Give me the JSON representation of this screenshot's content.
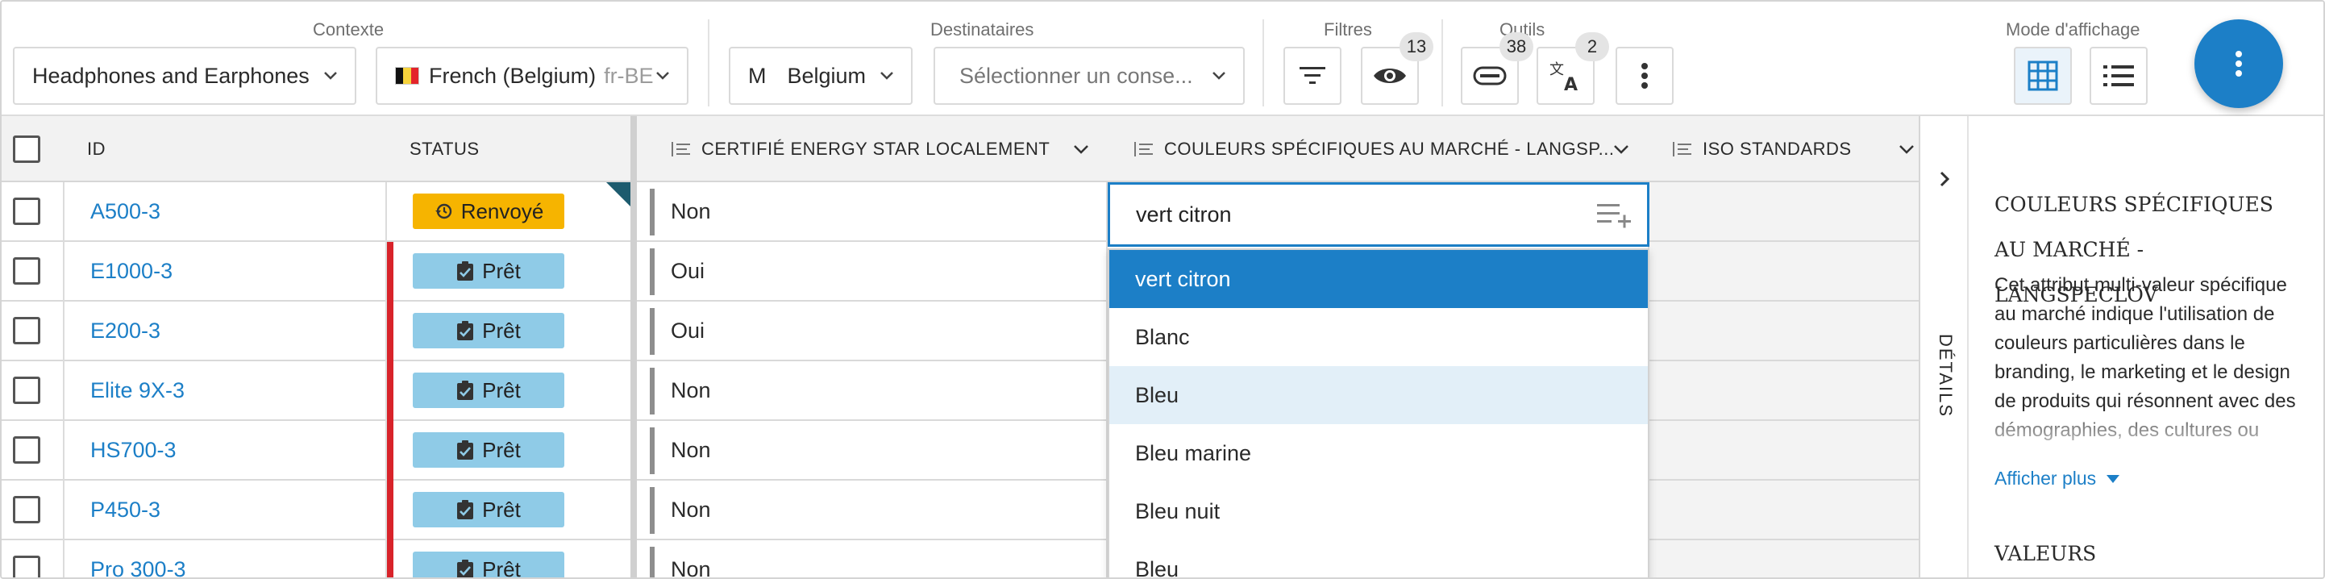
{
  "toolbar": {
    "groups": {
      "context": "Contexte",
      "recipients": "Destinataires",
      "filters": "Filtres",
      "tools": "Outils",
      "display_mode": "Mode d'affichage"
    },
    "category_select": "Headphones and Earphones",
    "locale_select": {
      "label": "French (Belgium)",
      "code": "fr-BE"
    },
    "market_select": {
      "prefix": "M",
      "label": "Belgium"
    },
    "advisor_select": {
      "placeholder": "Sélectionner un conse..."
    },
    "badges": {
      "visibility": "13",
      "link": "38",
      "translate": "2"
    },
    "colors": {
      "accent": "#1c7fc7",
      "ready": "#8fcbe7",
      "returned": "#f6b400",
      "error_bar": "#d8232a"
    }
  },
  "grid": {
    "columns": {
      "id": "ID",
      "status": "STATUS",
      "energy_star": "CERTIFIÉ ENERGY STAR LOCALEMENT",
      "colors": "COULEURS SPÉCIFIQUES AU MARCHÉ - LANGSP...",
      "iso": "ISO STANDARDS"
    },
    "rows": [
      {
        "id": "A500-3",
        "status": "Renvoyé",
        "status_kind": "returned",
        "energy": "Non"
      },
      {
        "id": "E1000-3",
        "status": "Prêt",
        "status_kind": "ready",
        "energy": "Oui"
      },
      {
        "id": "E200-3",
        "status": "Prêt",
        "status_kind": "ready",
        "energy": "Oui"
      },
      {
        "id": "Elite 9X-3",
        "status": "Prêt",
        "status_kind": "ready",
        "energy": "Non"
      },
      {
        "id": "HS700-3",
        "status": "Prêt",
        "status_kind": "ready",
        "energy": "Non"
      },
      {
        "id": "P450-3",
        "status": "Prêt",
        "status_kind": "ready",
        "energy": "Non"
      },
      {
        "id": "Pro 300-3",
        "status": "Prêt",
        "status_kind": "ready",
        "energy": "Non"
      }
    ],
    "edit": {
      "value": "vert citron",
      "options": [
        "vert citron",
        "Blanc",
        "Bleu",
        "Bleu marine",
        "Bleu nuit",
        "Bleu"
      ]
    }
  },
  "details": {
    "tab_label": "DÉTAILS",
    "title": "COULEURS SPÉCIFIQUES AU MARCHÉ - LANGSPECLOV",
    "description": "Cet attribut multi-valeur spécifique au marché indique l'utilisation de couleurs particulières dans le branding, le marketing et le design de produits qui résonnent avec des démographies, des cultures ou",
    "show_more": "Afficher plus",
    "values_heading": "VALEURS"
  }
}
